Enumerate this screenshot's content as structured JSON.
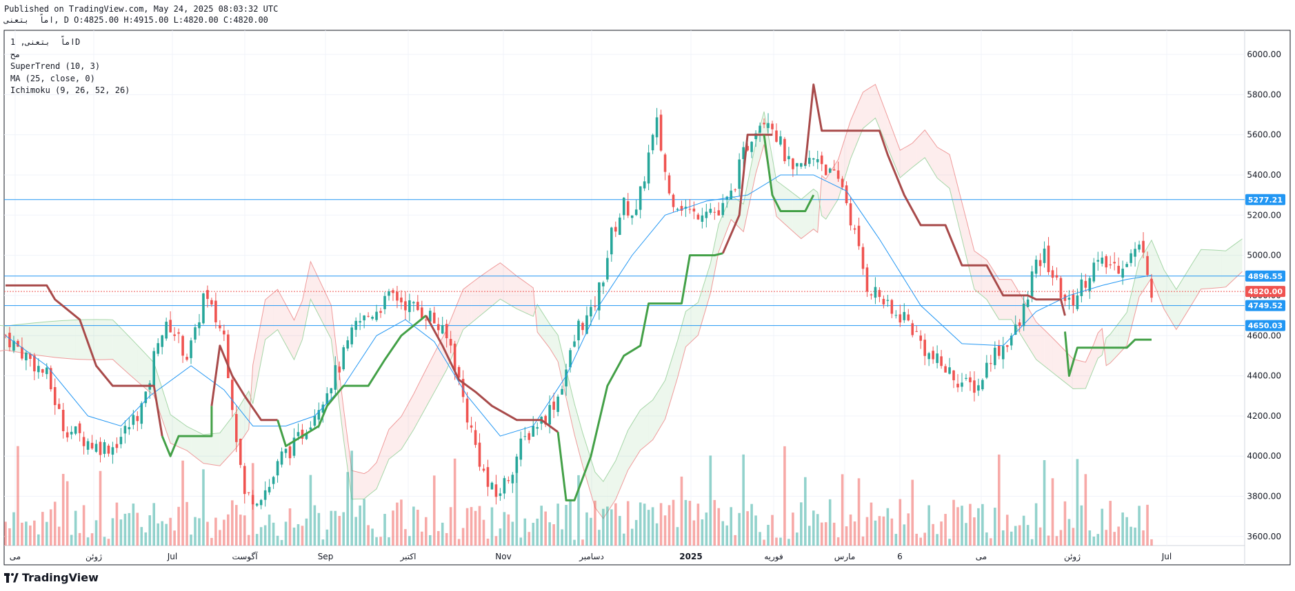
{
  "header": {
    "published": "Published on TradingView.com, May 24, 2025 08:03:32 UTC",
    "ohlc_line": "اماً  بتعنى, D O:4825.00 H:4915.00 L:4820.00 C:4820.00"
  },
  "legend": {
    "symbol": "اماً  بتعنى, 1D",
    "sub": "مح",
    "supertrend": "SuperTrend (10, 3)",
    "ma": "MA (25, close, 0)",
    "ichimoku": "Ichimoku (9, 26, 52, 26)"
  },
  "brand": {
    "name": "TradingView",
    "icon": "tradingview-logo-icon"
  },
  "colors": {
    "up": "#26a69a",
    "down": "#ef5350",
    "supertrend_up": "#43a047",
    "supertrend_down": "#a84a4a",
    "ma": "#2196f3",
    "hline": "#2196f3",
    "cloud_bull": "#4caf50",
    "cloud_bear": "#ef5350"
  },
  "chart_data": {
    "type": "candlestick",
    "title": "",
    "xlabel": "",
    "ylabel": "",
    "ylim": [
      3555,
      6120
    ],
    "y_ticks": [
      "6000.00",
      "5800.00",
      "5600.00",
      "5400.00",
      "5200.00",
      "5000.00",
      "4800.00",
      "4600.00",
      "4400.00",
      "4200.00",
      "4000.00",
      "3800.00",
      "3600.00"
    ],
    "x_ticks": [
      "مى",
      "ژوئن",
      "Jul",
      "آگوست",
      "Sep",
      "اکتبر",
      "Nov",
      "دسامبر",
      "2025",
      "فوریه",
      "مارس",
      "6",
      "مى",
      "ژوئن",
      "Jul"
    ],
    "price_labels": [
      {
        "value": "5277.21",
        "price": 5277.21,
        "color": "#2196f3"
      },
      {
        "value": "4896.55",
        "price": 4896.55,
        "color": "#2196f3"
      },
      {
        "value": "4820.00",
        "price": 4820.0,
        "color": "#ef5350"
      },
      {
        "value": "4749.52",
        "price": 4749.52,
        "color": "#2196f3"
      },
      {
        "value": "4650.03",
        "price": 4650.03,
        "color": "#2196f3"
      }
    ],
    "horizontal_lines": [
      5277.21,
      4896.55,
      4749.52,
      4650.03
    ],
    "last_close": 4820.0,
    "series": {
      "close_path": [
        [
          0,
          4600
        ],
        [
          5,
          4500
        ],
        [
          10,
          4400
        ],
        [
          14,
          4150
        ],
        [
          18,
          4100
        ],
        [
          22,
          4050
        ],
        [
          26,
          4050
        ],
        [
          30,
          4150
        ],
        [
          34,
          4280
        ],
        [
          37,
          4600
        ],
        [
          40,
          4650
        ],
        [
          44,
          4500
        ],
        [
          46,
          4600
        ],
        [
          48,
          4800
        ],
        [
          53,
          4600
        ],
        [
          56,
          4100
        ],
        [
          58,
          3800
        ],
        [
          61,
          3800
        ],
        [
          64,
          3850
        ],
        [
          67,
          4000
        ],
        [
          70,
          4050
        ],
        [
          73,
          4150
        ],
        [
          77,
          4300
        ],
        [
          81,
          4450
        ],
        [
          85,
          4650
        ],
        [
          88,
          4700
        ],
        [
          91,
          4750
        ],
        [
          94,
          4800
        ],
        [
          98,
          4750
        ],
        [
          103,
          4700
        ],
        [
          108,
          4550
        ],
        [
          112,
          4200
        ],
        [
          114,
          4050
        ],
        [
          117,
          3850
        ],
        [
          119,
          3800
        ],
        [
          122,
          3900
        ],
        [
          125,
          4050
        ],
        [
          128,
          4150
        ],
        [
          131,
          4200
        ],
        [
          134,
          4300
        ],
        [
          137,
          4500
        ],
        [
          139,
          4650
        ],
        [
          142,
          4700
        ],
        [
          145,
          4900
        ],
        [
          147,
          5100
        ],
        [
          150,
          5250
        ],
        [
          153,
          5200
        ],
        [
          156,
          5500
        ],
        [
          158,
          5650
        ],
        [
          161,
          5300
        ],
        [
          164,
          5250
        ],
        [
          167,
          5200
        ],
        [
          170,
          5250
        ],
        [
          173,
          5200
        ],
        [
          176,
          5300
        ],
        [
          179,
          5500
        ],
        [
          182,
          5650
        ],
        [
          185,
          5700
        ],
        [
          188,
          5550
        ],
        [
          191,
          5400
        ],
        [
          194,
          5450
        ],
        [
          197,
          5500
        ],
        [
          200,
          5400
        ],
        [
          203,
          5350
        ],
        [
          206,
          5100
        ],
        [
          209,
          4850
        ],
        [
          212,
          4800
        ],
        [
          215,
          4700
        ],
        [
          218,
          4700
        ],
        [
          221,
          4600
        ],
        [
          224,
          4500
        ],
        [
          227,
          4450
        ],
        [
          230,
          4400
        ],
        [
          233,
          4350
        ],
        [
          236,
          4350
        ],
        [
          239,
          4500
        ],
        [
          242,
          4550
        ],
        [
          246,
          4650
        ],
        [
          249,
          4900
        ],
        [
          252,
          5000
        ],
        [
          255,
          4850
        ],
        [
          258,
          4750
        ],
        [
          261,
          4850
        ],
        [
          264,
          4950
        ],
        [
          267,
          4950
        ],
        [
          270,
          4950
        ],
        [
          273,
          5000
        ],
        [
          276,
          5050
        ],
        [
          278,
          4820
        ]
      ],
      "ma_path": [
        [
          0,
          4600
        ],
        [
          10,
          4450
        ],
        [
          20,
          4200
        ],
        [
          28,
          4150
        ],
        [
          35,
          4300
        ],
        [
          45,
          4450
        ],
        [
          53,
          4330
        ],
        [
          60,
          4150
        ],
        [
          68,
          4150
        ],
        [
          75,
          4200
        ],
        [
          82,
          4350
        ],
        [
          90,
          4600
        ],
        [
          97,
          4680
        ],
        [
          104,
          4570
        ],
        [
          112,
          4300
        ],
        [
          120,
          4100
        ],
        [
          128,
          4150
        ],
        [
          136,
          4400
        ],
        [
          144,
          4750
        ],
        [
          152,
          5000
        ],
        [
          160,
          5200
        ],
        [
          170,
          5270
        ],
        [
          180,
          5300
        ],
        [
          188,
          5400
        ],
        [
          196,
          5400
        ],
        [
          204,
          5320
        ],
        [
          212,
          5080
        ],
        [
          222,
          4750
        ],
        [
          232,
          4560
        ],
        [
          242,
          4550
        ],
        [
          250,
          4720
        ],
        [
          258,
          4800
        ],
        [
          266,
          4850
        ],
        [
          272,
          4880
        ],
        [
          278,
          4900
        ]
      ],
      "supertrend": [
        {
          "trend": "down",
          "points": [
            [
              0,
              4850
            ],
            [
              10,
              4850
            ],
            [
              12,
              4780
            ],
            [
              18,
              4680
            ],
            [
              22,
              4450
            ],
            [
              26,
              4350
            ],
            [
              36,
              4350
            ],
            [
              38,
              4100
            ]
          ]
        },
        {
          "trend": "up",
          "points": [
            [
              38,
              4100
            ],
            [
              40,
              4000
            ],
            [
              42,
              4100
            ],
            [
              50,
              4100
            ],
            [
              50,
              4250
            ]
          ]
        },
        {
          "trend": "down",
          "points": [
            [
              50,
              4250
            ],
            [
              52,
              4550
            ],
            [
              55,
              4400
            ],
            [
              58,
              4300
            ],
            [
              62,
              4180
            ],
            [
              66,
              4180
            ]
          ]
        },
        {
          "trend": "up",
          "points": [
            [
              66,
              4180
            ],
            [
              68,
              4050
            ],
            [
              72,
              4100
            ],
            [
              76,
              4150
            ],
            [
              78,
              4250
            ],
            [
              82,
              4350
            ],
            [
              88,
              4350
            ],
            [
              92,
              4480
            ],
            [
              96,
              4600
            ],
            [
              102,
              4700
            ]
          ]
        },
        {
          "trend": "down",
          "points": [
            [
              102,
              4700
            ],
            [
              106,
              4550
            ],
            [
              110,
              4380
            ],
            [
              114,
              4320
            ],
            [
              118,
              4250
            ],
            [
              124,
              4180
            ],
            [
              130,
              4180
            ],
            [
              134,
              4120
            ]
          ]
        },
        {
          "trend": "up",
          "points": [
            [
              134,
              4120
            ],
            [
              136,
              3780
            ],
            [
              138,
              3780
            ],
            [
              142,
              4000
            ],
            [
              146,
              4350
            ],
            [
              150,
              4500
            ],
            [
              154,
              4550
            ],
            [
              156,
              4760
            ],
            [
              164,
              4760
            ],
            [
              166,
              5000
            ],
            [
              172,
              5000
            ],
            [
              174,
              5010
            ]
          ]
        },
        {
          "trend": "down",
          "points": [
            [
              174,
              5010
            ],
            [
              178,
              5200
            ],
            [
              180,
              5600
            ],
            [
              186,
              5600
            ],
            [
              186,
              5600
            ]
          ]
        },
        {
          "trend": "up",
          "points": [
            [
              184,
              5600
            ],
            [
              186,
              5300
            ],
            [
              188,
              5220
            ],
            [
              194,
              5220
            ],
            [
              196,
              5300
            ]
          ]
        },
        {
          "trend": "down",
          "points": [
            [
              194,
              5450
            ],
            [
              196,
              5850
            ],
            [
              198,
              5620
            ],
            [
              204,
              5620
            ],
            [
              212,
              5620
            ],
            [
              214,
              5500
            ],
            [
              218,
              5300
            ],
            [
              222,
              5150
            ],
            [
              228,
              5150
            ],
            [
              232,
              4950
            ],
            [
              238,
              4950
            ],
            [
              242,
              4800
            ],
            [
              248,
              4800
            ],
            [
              250,
              4780
            ],
            [
              256,
              4780
            ],
            [
              257,
              4700
            ]
          ]
        },
        {
          "trend": "up",
          "points": [
            [
              257,
              4620
            ],
            [
              258,
              4400
            ],
            [
              260,
              4540
            ],
            [
              262,
              4540
            ],
            [
              272,
              4540
            ],
            [
              274,
              4580
            ],
            [
              278,
              4580
            ]
          ]
        }
      ]
    }
  }
}
